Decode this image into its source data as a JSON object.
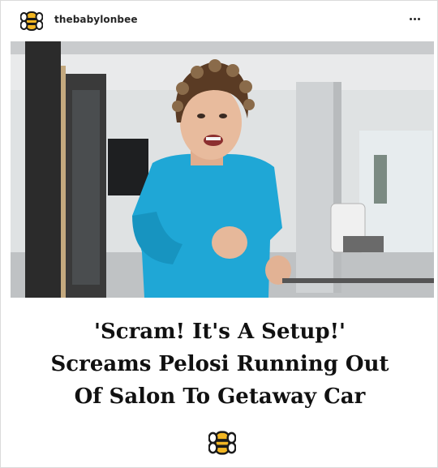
{
  "post": {
    "username": "thebabylonbee",
    "avatar_icon": "babylon-bee-logo-icon",
    "more_icon": "more-options-icon"
  },
  "image": {
    "description_icon": "photo-woman-running-from-salon"
  },
  "headline": {
    "line1": "'Scram! It's A Setup!'",
    "line2": "Screams Pelosi Running Out",
    "line3": "Of Salon To Getaway Car"
  },
  "footer": {
    "logo_icon": "babylon-bee-logo-icon"
  },
  "colors": {
    "bee_yellow": "#f2b623",
    "bee_black": "#1a1a1a",
    "shirt_cyan": "#1fa7d6"
  }
}
